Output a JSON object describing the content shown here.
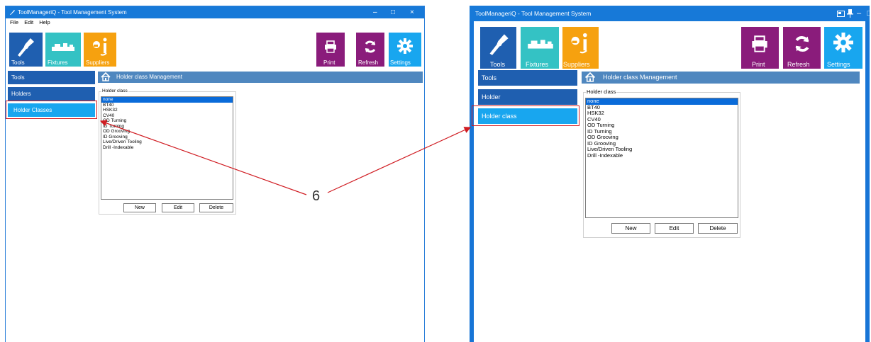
{
  "left": {
    "title": "ToolManageriQ - Tool Management System",
    "controls": {
      "min": "–",
      "max": "□",
      "close": "×"
    },
    "menu": [
      "File",
      "Edit",
      "Help"
    ],
    "toolbar": {
      "tools": "Tools",
      "fixtures": "Fixtures",
      "suppliers": "Suppliers",
      "print": "Print",
      "refresh": "Refresh",
      "settings": "Settings"
    },
    "nav": [
      "Tools",
      "Holders",
      "Holder Classes"
    ],
    "header": "Holder class Management",
    "groupbox": "Holder class",
    "list": [
      "none",
      "BT40",
      "HSK32",
      "CV40",
      "OD Turning",
      "ID Turning",
      "OD Grooving",
      "ID Grooving",
      "Live/Driven Tooling",
      "Drill -Indexable"
    ],
    "selected": "none",
    "buttons": {
      "new": "New",
      "edit": "Edit",
      "delete": "Delete"
    }
  },
  "right": {
    "title": "ToolManageriQ - Tool Management System",
    "controls": {
      "min": "–",
      "max": "□",
      "close": "×"
    },
    "toolbar": {
      "tools": "Tools",
      "fixtures": "Fixtures",
      "suppliers": "Suppliers",
      "print": "Print",
      "refresh": "Refresh",
      "settings": "Settings"
    },
    "nav": [
      "Tools",
      "Holder",
      "Holder class"
    ],
    "header": "Holder class Management",
    "groupbox": "Holder class",
    "list": [
      "none",
      "BT40",
      "HSK32",
      "CV40",
      "OD Turning",
      "ID Turning",
      "OD Grooving",
      "ID Grooving",
      "Live/Driven Tooling",
      "Drill -Indexable"
    ],
    "selected": "none",
    "buttons": {
      "new": "New",
      "edit": "Edit",
      "delete": "Delete"
    }
  },
  "callout": "6",
  "colors": {
    "titlebar": "#1779d8",
    "tools_tile": "#1f5fb0",
    "fixtures_tile": "#34c2c4",
    "suppliers_tile": "#f6a10f",
    "print_tile": "#8a1c7b",
    "refresh_tile": "#8a1c7b",
    "settings_tile": "#18a6ef",
    "nav_dark": "#1f5fb0",
    "nav_active": "#18a6ef",
    "header": "#4f87bf",
    "selection": "#0a6bd9",
    "highlight": "#d01c22"
  }
}
